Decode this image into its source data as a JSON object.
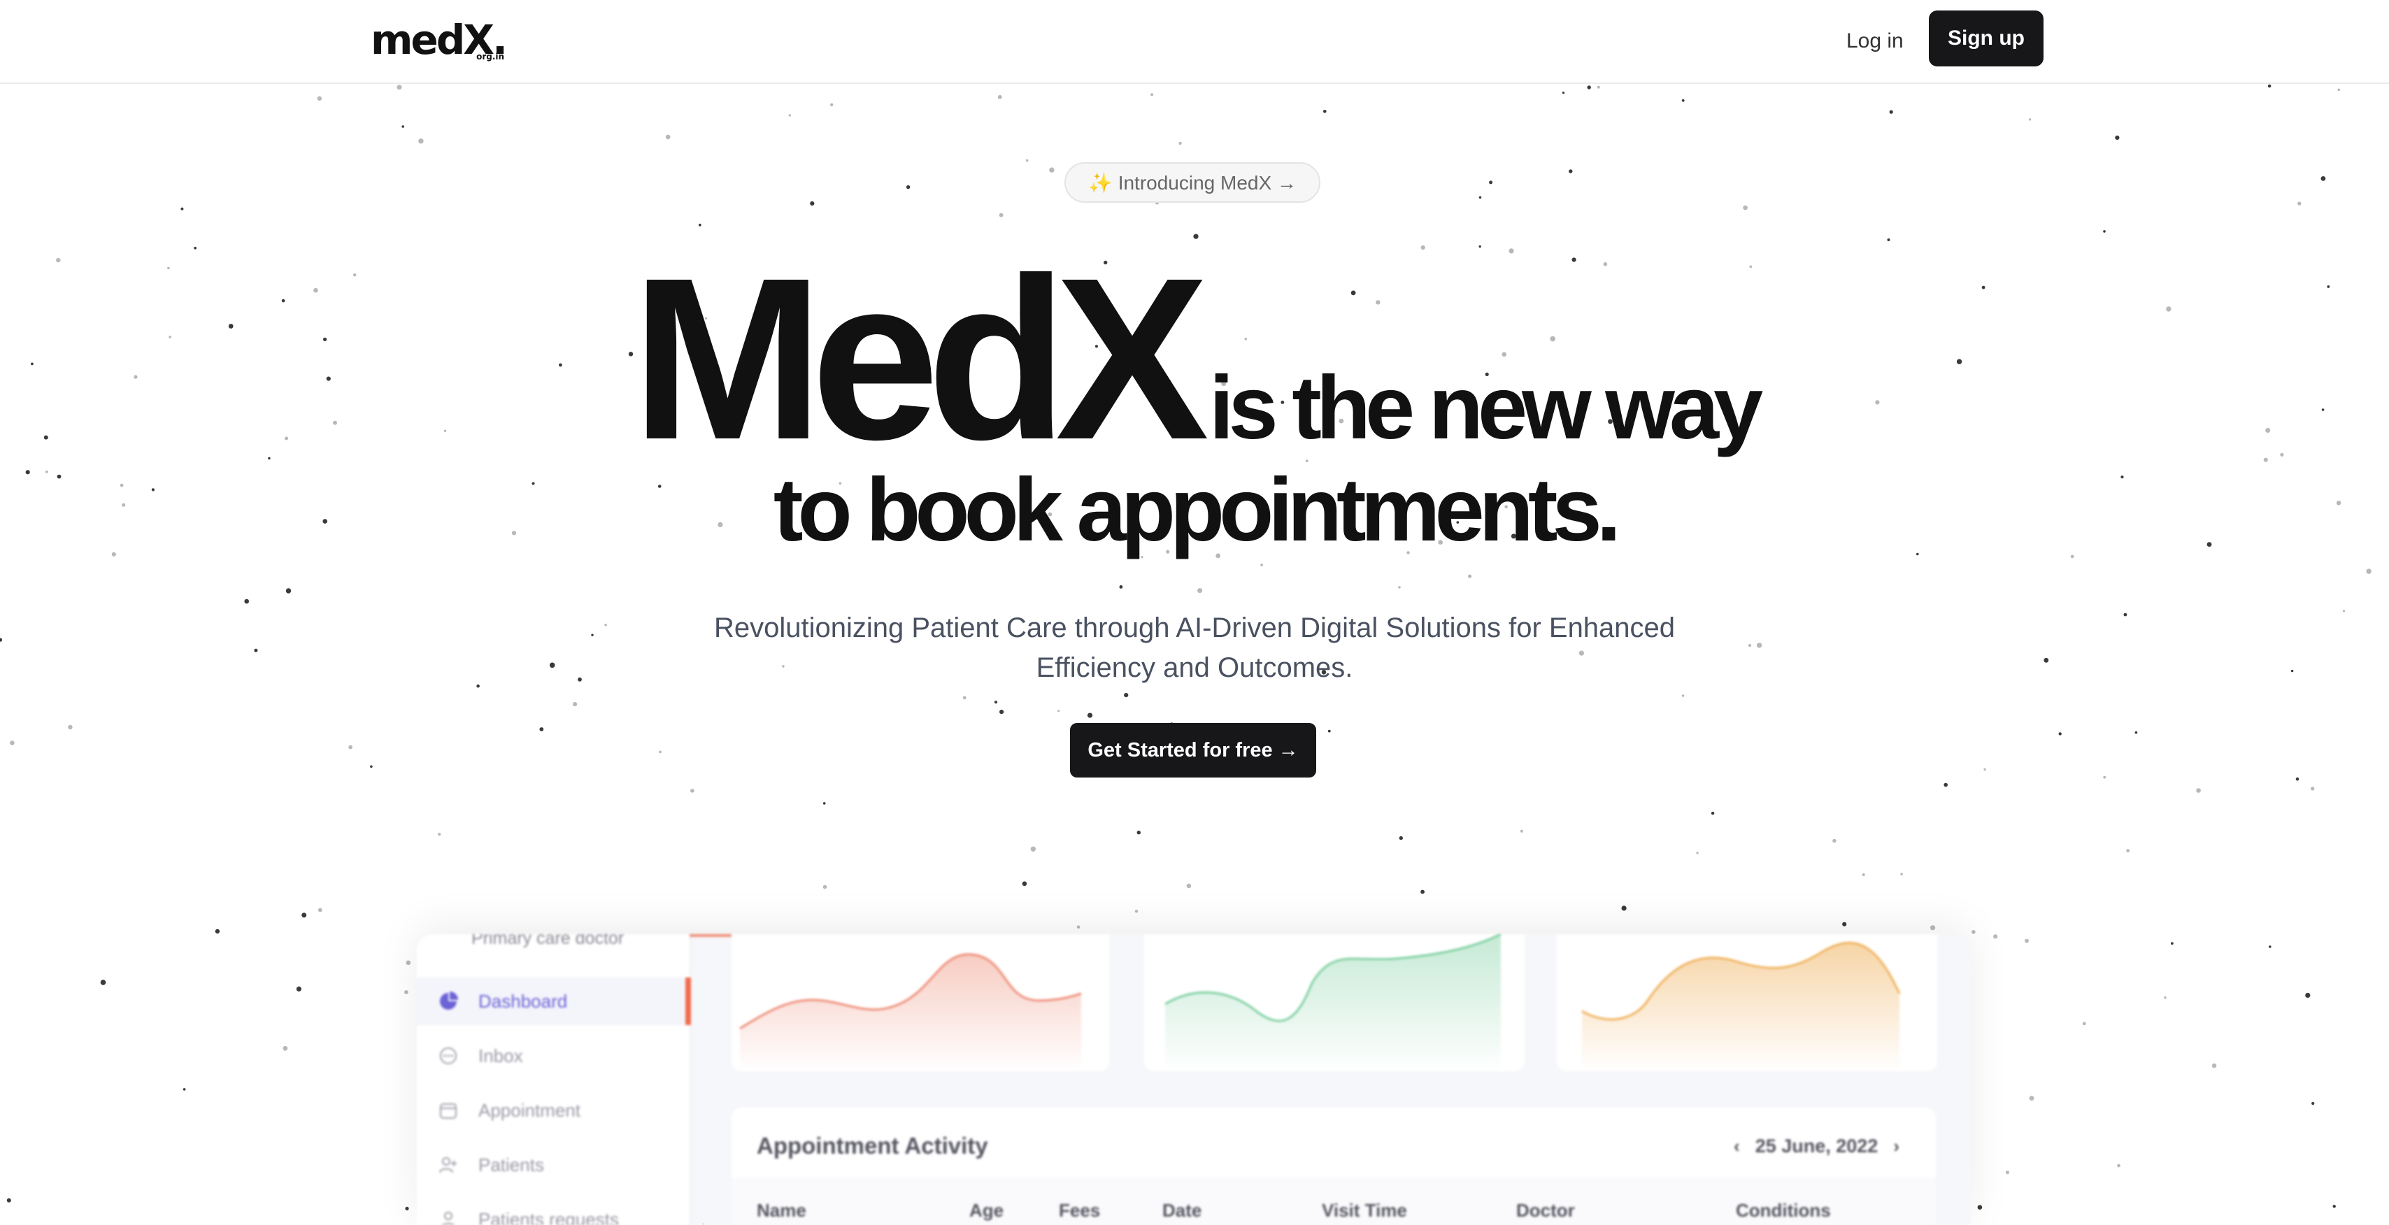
{
  "header": {
    "logo_text": "medX.",
    "logo_sub": "org.in",
    "login_label": "Log in",
    "signup_label": "Sign up"
  },
  "hero": {
    "badge": "✨ Introducing MedX →",
    "title_big": "MedX",
    "title_tail": "is the new way",
    "title_line2": "to book appointments.",
    "subtitle": "Revolutionizing Patient Care through AI-Driven Digital Solutions for Enhanced Efficiency and Outcomes.",
    "cta_label": "Get Started for free →"
  },
  "preview": {
    "sidebar": {
      "doctor_label": "Primary care doctor",
      "items": [
        {
          "label": "Dashboard",
          "icon": "pie-chart-icon",
          "active": true
        },
        {
          "label": "Inbox",
          "icon": "chat-icon",
          "active": false
        },
        {
          "label": "Appointment",
          "icon": "calendar-icon",
          "active": false
        },
        {
          "label": "Patients",
          "icon": "user-add-icon",
          "active": false
        },
        {
          "label": "Patients requests",
          "icon": "user-icon",
          "active": false
        }
      ]
    },
    "charts": [
      {
        "color": "#ee8e78"
      },
      {
        "color": "#7fd0a2"
      },
      {
        "color": "#f0b25e"
      }
    ],
    "table": {
      "title": "Appointment Activity",
      "date": "25 June, 2022",
      "columns": [
        "Name",
        "Age",
        "Fees",
        "Date",
        "Visit Time",
        "Doctor",
        "Conditions"
      ]
    }
  },
  "colors": {
    "primary_button": "#17171a",
    "accent_purple": "#6c63d6",
    "accent_orange": "#f26b4e"
  }
}
